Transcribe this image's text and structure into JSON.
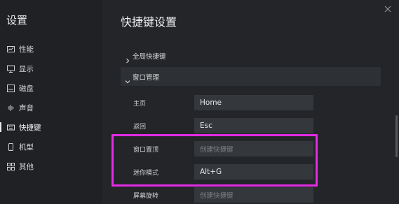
{
  "sidebar": {
    "title": "设置",
    "items": [
      {
        "label": "性能",
        "icon": "performance-icon"
      },
      {
        "label": "显示",
        "icon": "monitor-icon"
      },
      {
        "label": "磁盘",
        "icon": "disk-icon"
      },
      {
        "label": "声音",
        "icon": "sound-icon"
      },
      {
        "label": "快捷键",
        "icon": "shortcut-icon",
        "active": true
      },
      {
        "label": "机型",
        "icon": "device-icon"
      },
      {
        "label": "其他",
        "icon": "grid-icon"
      }
    ]
  },
  "main": {
    "heading": "快捷键设置",
    "sections": {
      "global": "全局快捷键",
      "window": "窗口管理"
    },
    "rows": [
      {
        "label": "主页",
        "value": "Home",
        "placeholder": ""
      },
      {
        "label": "返回",
        "value": "Esc",
        "placeholder": ""
      },
      {
        "label": "窗口置顶",
        "value": "",
        "placeholder": "创建快捷键"
      },
      {
        "label": "迷你模式",
        "value": "Alt+G",
        "placeholder": ""
      },
      {
        "label": "屏幕旋转",
        "value": "",
        "placeholder": "创建快捷键"
      }
    ]
  },
  "colors": {
    "highlight": "#e42be6",
    "sidebar_bg": "#1f2124",
    "main_bg": "#232529",
    "field_bg": "#34373c"
  }
}
